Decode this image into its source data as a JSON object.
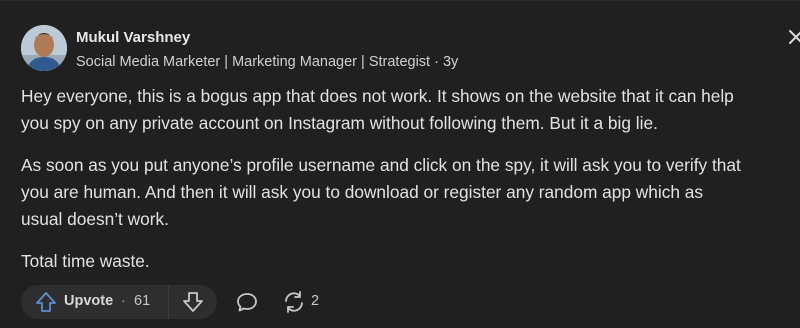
{
  "author": {
    "name": "Mukul Varshney",
    "credentials": "Social Media Marketer | Marketing Manager | Strategist",
    "time_ago": "3y"
  },
  "answer": {
    "paragraphs": [
      "Hey everyone, this is a bogus app that does not work. It shows on the website that it can help",
      "you spy on any private account on Instagram without following them. But it a big lie.",
      "As soon as you put anyone’s profile username and click on the spy, it will ask you to verify that",
      "you are human. And then it will ask you to download or register any random app which as",
      "usual doesn’t work.",
      "Total time waste."
    ]
  },
  "actions": {
    "upvote_label": "Upvote",
    "dot": "·",
    "upvote_count": "61",
    "share_count": "2"
  },
  "colors": {
    "background": "#202020",
    "accent_upvote": "#5a8fd6",
    "text": "#e2e2e2"
  },
  "icons": [
    "close-icon",
    "upvote-arrow-icon",
    "downvote-arrow-icon",
    "comment-icon",
    "share-icon"
  ]
}
